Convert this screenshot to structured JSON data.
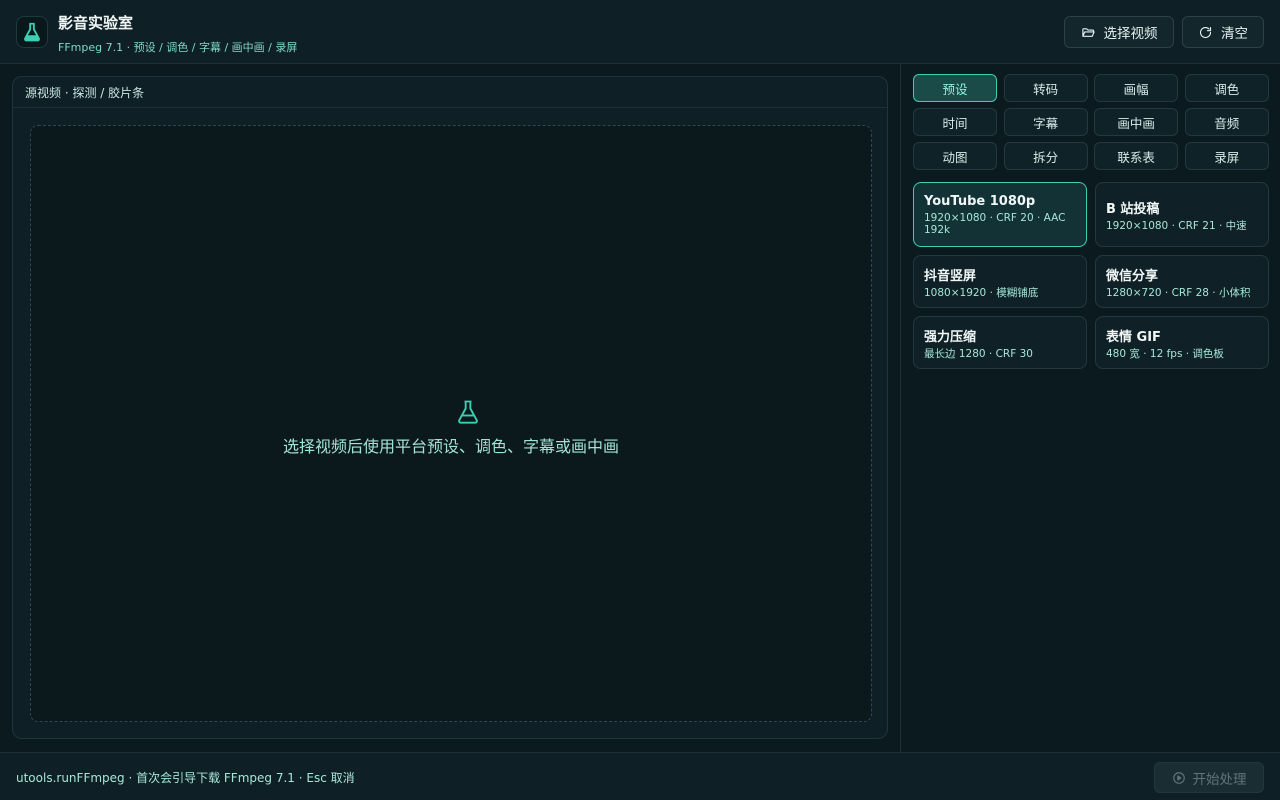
{
  "app": {
    "title": "影音实验室",
    "subtitle": "FFmpeg 7.1 · 预设 / 调色 / 字幕 / 画中画 / 录屏"
  },
  "header": {
    "select_label": "选择视频",
    "clear_label": "清空"
  },
  "main": {
    "section_label": "源视频 · 探测 / 胶片条",
    "empty_text": "选择视频后使用平台预设、调色、字幕或画中画"
  },
  "tabs": [
    {
      "label": "预设",
      "active": true
    },
    {
      "label": "转码"
    },
    {
      "label": "画幅"
    },
    {
      "label": "调色"
    },
    {
      "label": "时间"
    },
    {
      "label": "字幕"
    },
    {
      "label": "画中画"
    },
    {
      "label": "音频"
    },
    {
      "label": "动图"
    },
    {
      "label": "拆分"
    },
    {
      "label": "联系表"
    },
    {
      "label": "录屏"
    }
  ],
  "presets": [
    {
      "name": "YouTube 1080p",
      "desc": "1920×1080 · CRF 20 · AAC 192k",
      "active": true
    },
    {
      "name": "B 站投稿",
      "desc": "1920×1080 · CRF 21 · 中速"
    },
    {
      "name": "抖音竖屏",
      "desc": "1080×1920 · 模糊铺底"
    },
    {
      "name": "微信分享",
      "desc": "1280×720 · CRF 28 · 小体积"
    },
    {
      "name": "强力压缩",
      "desc": "最长边 1280 · CRF 30"
    },
    {
      "name": "表情 GIF",
      "desc": "480 宽 · 12 fps · 调色板"
    }
  ],
  "footer": {
    "hint": "utools.runFFmpeg · 首次会引导下载 FFmpeg 7.1 · Esc 取消",
    "start_label": "开始处理"
  },
  "colors": {
    "accent": "#3dcfb1",
    "background": "#0b1a1f"
  }
}
